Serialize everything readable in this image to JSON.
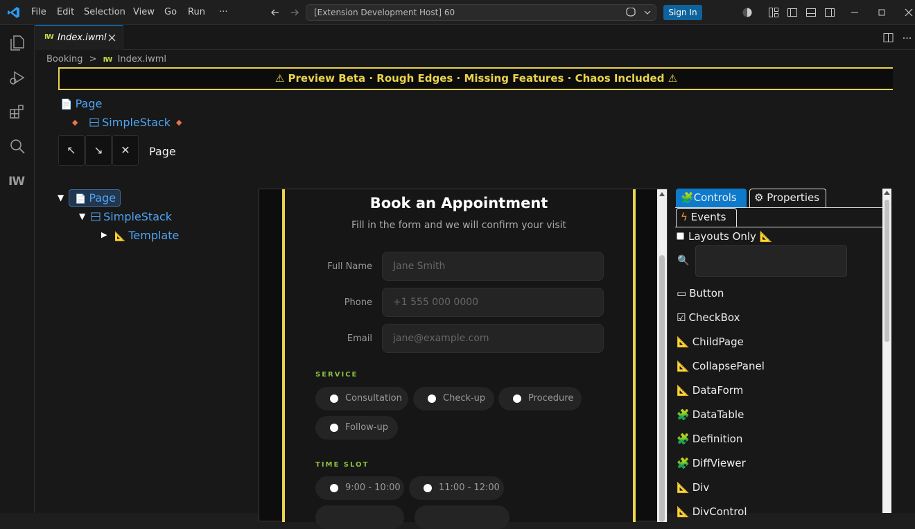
{
  "titlebar": {
    "menu": [
      "File",
      "Edit",
      "Selection",
      "View",
      "Go",
      "Run",
      "···"
    ],
    "command_center": "[Extension Development Host] 60",
    "sign_in": "Sign In"
  },
  "tab": {
    "label": "Index.iwml",
    "badge": "IW"
  },
  "activity": {
    "iw": "IW"
  },
  "breadcrumb": {
    "root": "Booking",
    "sep": ">",
    "badge": "IW",
    "file": "Index.iwml"
  },
  "banner": "⚠ Preview Beta · Rough Edges · Missing Features · Chaos Included ⚠",
  "selection": {
    "page": "Page",
    "stack": "SimpleStack",
    "diamond": "◆"
  },
  "nav": {
    "up": "↖",
    "down": "↘",
    "close": "✕",
    "label": "Page"
  },
  "tree": {
    "page": "Page",
    "stack": "SimpleStack",
    "template": "Template",
    "open": "▼",
    "closed": "▶"
  },
  "form": {
    "title": "Book an Appointment",
    "subtitle": "Fill in the form and we will confirm your visit",
    "fields": [
      {
        "label": "Full Name",
        "placeholder": "Jane Smith"
      },
      {
        "label": "Phone",
        "placeholder": "+1 555 000 0000"
      },
      {
        "label": "Email",
        "placeholder": "jane@example.com"
      }
    ],
    "service_label": "SERVICE",
    "services": [
      "Consultation",
      "Check-up",
      "Procedure",
      "Follow-up"
    ],
    "slot_label": "TIME SLOT",
    "slots": [
      "9:00 - 10:00",
      "11:00 - 12:00"
    ]
  },
  "panel": {
    "tabs": {
      "controls": "Controls",
      "properties": "Properties",
      "events": "Events"
    },
    "layouts_only": "Layouts Only",
    "items": [
      {
        "icon": "▭",
        "label": "Button"
      },
      {
        "icon": "☑",
        "label": "CheckBox"
      },
      {
        "icon": "📐",
        "label": "ChildPage"
      },
      {
        "icon": "📐",
        "label": "CollapsePanel"
      },
      {
        "icon": "📐",
        "label": "DataForm"
      },
      {
        "icon": "🧩",
        "label": "DataTable"
      },
      {
        "icon": "🧩",
        "label": "Definition"
      },
      {
        "icon": "🧩",
        "label": "DiffViewer"
      },
      {
        "icon": "📐",
        "label": "Div"
      },
      {
        "icon": "📐",
        "label": "DivControl"
      }
    ]
  },
  "colors": {
    "accent": "#0078d4",
    "banner": "#e8d44d",
    "link": "#4ea4f4",
    "section": "#8fbf3f",
    "controls_tab": "#0e7acc"
  }
}
